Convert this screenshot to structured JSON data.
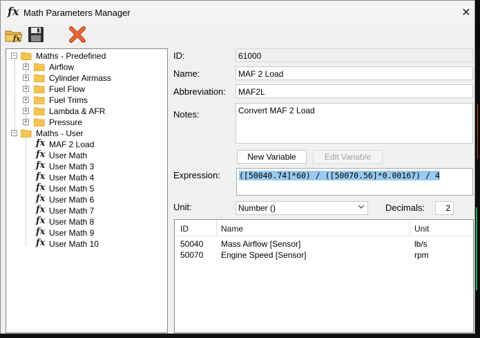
{
  "window": {
    "title": "Math Parameters Manager",
    "title_icon": "fx",
    "close_glyph": "✕"
  },
  "toolbar": {
    "open_icon": "folder-fx-icon",
    "save_icon": "floppy-disk-icon",
    "delete_icon": "red-x-icon"
  },
  "tree": {
    "predefined_label": "Maths - Predefined",
    "predefined_children": [
      "Airflow",
      "Cylinder Airmass",
      "Fuel Flow",
      "Fuel Trims",
      "Lambda & AFR",
      "Pressure"
    ],
    "user_label": "Maths - User",
    "user_children": [
      "MAF 2 Load",
      "User Math",
      "User Math 3",
      "User Math 4",
      "User Math 5",
      "User Math 6",
      "User Math 7",
      "User Math 8",
      "User Math 9",
      "User Math 10"
    ],
    "expand_glyph": "+",
    "collapse_glyph": "−",
    "item_icon": "fx"
  },
  "form": {
    "id_label": "ID:",
    "id_value": "61000",
    "name_label": "Name:",
    "name_value": "MAF 2 Load",
    "abbr_label": "Abbreviation:",
    "abbr_value": "MAF2L",
    "notes_label": "Notes:",
    "notes_value": "Convert MAF 2 Load",
    "new_variable_label": "New Variable",
    "edit_variable_label": "Edit Variable",
    "expression_label": "Expression:",
    "expression_value": "([50040.74]*60) / ([50070.56]*0.00167) / 4",
    "unit_label": "Unit:",
    "unit_value": "Number ()",
    "decimals_label": "Decimals:",
    "decimals_value": "2"
  },
  "variables_table": {
    "columns": [
      "ID",
      "Name",
      "Unit"
    ],
    "rows": [
      {
        "id": "50040",
        "name": "Mass Airflow [Sensor]",
        "unit": "lb/s"
      },
      {
        "id": "50070",
        "name": "Engine Speed [Sensor]",
        "unit": "rpm"
      }
    ]
  },
  "colors": {
    "selection": "#99c9ef",
    "delete_red": "#e0522a",
    "folder_yellow": "#f5c451"
  }
}
